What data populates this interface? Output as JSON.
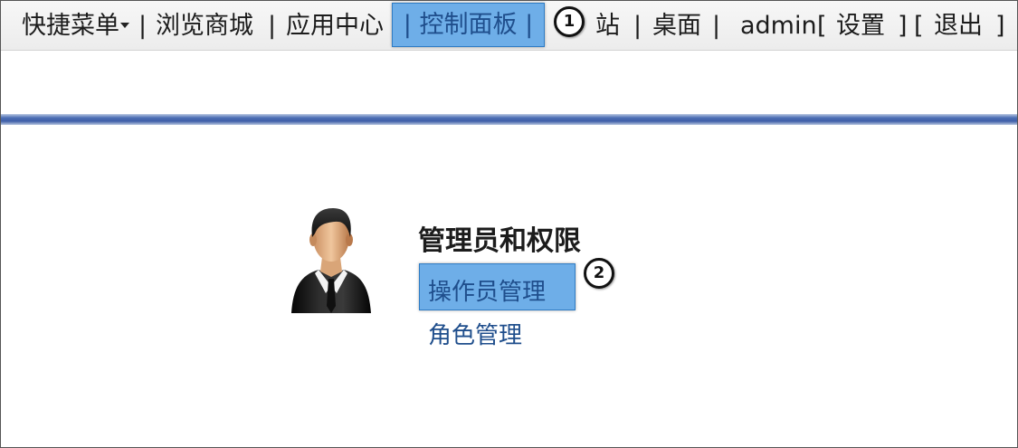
{
  "nav": {
    "quick_menu": "快捷菜单",
    "sep": "|",
    "browse_mall": "浏览商城",
    "app_center": "应用中心",
    "control_panel": "控制面板",
    "site_obscured": "站",
    "desktop": "桌面",
    "username": "admin",
    "settings": "设置",
    "logout": "退出",
    "bracket_open": "[",
    "bracket_close": "]"
  },
  "steps": {
    "step1": "1",
    "step2": "2"
  },
  "permissions": {
    "title": "管理员和权限",
    "operator_management": "操作员管理",
    "role_management": "角色管理"
  },
  "icons": {
    "caret": "caret-down-icon",
    "avatar": "admin-avatar-icon"
  },
  "colors": {
    "highlight": "#6eaee8",
    "link": "#1f4e8c",
    "separator_bar": "#4d6fb5"
  }
}
